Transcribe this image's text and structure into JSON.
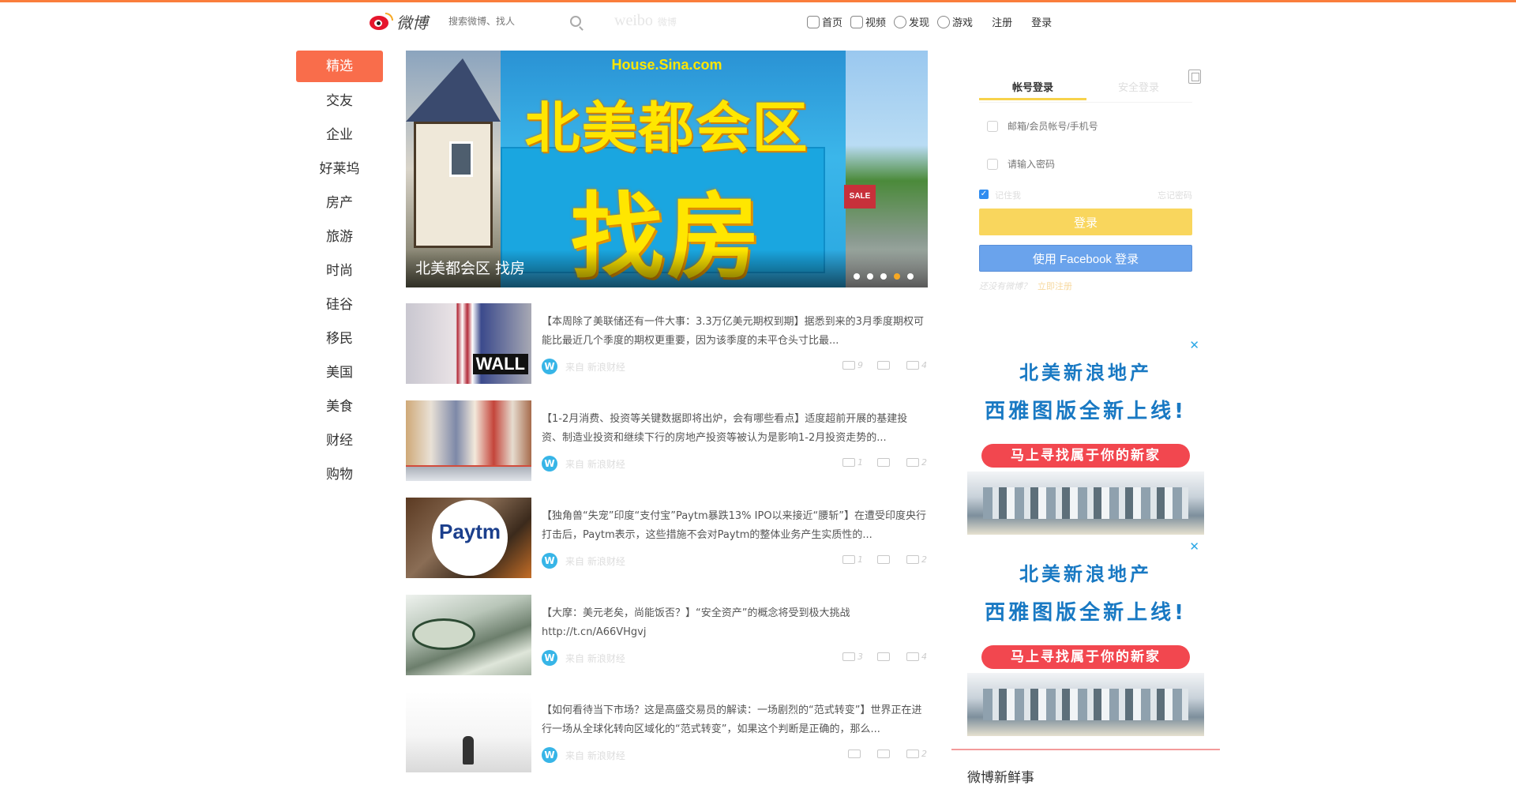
{
  "header": {
    "logo_text": "微博",
    "search_placeholder": "搜索微博、找人",
    "brand": "weibo",
    "brand_sub": "微博",
    "nav": [
      {
        "label": "首页",
        "icon": "home-icon"
      },
      {
        "label": "视频",
        "icon": "video-icon"
      },
      {
        "label": "发现",
        "icon": "discover-icon"
      },
      {
        "label": "游戏",
        "icon": "game-icon"
      }
    ],
    "register": "注册",
    "login": "登录"
  },
  "sidebar": {
    "items": [
      {
        "label": "精选",
        "active": true
      },
      {
        "label": "交友"
      },
      {
        "label": "企业"
      },
      {
        "label": "好莱坞"
      },
      {
        "label": "房产"
      },
      {
        "label": "旅游"
      },
      {
        "label": "时尚"
      },
      {
        "label": "硅谷"
      },
      {
        "label": "移民"
      },
      {
        "label": "美国"
      },
      {
        "label": "美食"
      },
      {
        "label": "财经"
      },
      {
        "label": "购物"
      }
    ]
  },
  "banner": {
    "site": "House.Sina.com",
    "headline": "北美都会区",
    "headline2": "找房",
    "sale_sign": "SALE",
    "caption": "北美都会区 找房",
    "slide_count": 5,
    "active_slide": 4
  },
  "feed": {
    "posts": [
      {
        "text": "【本周除了美联储还有一件大事：3.3万亿美元期权到期】据悉到来的3月季度期权可能比最近几个季度的期权更重要，因为该季度的未平仓头寸比最...",
        "thumb_label": "WALL",
        "source": "来自 新浪财经",
        "actions": [
          "9",
          "",
          "4"
        ]
      },
      {
        "text": "【1-2月消费、投资等关键数据即将出炉，会有哪些看点】适度超前开展的基建投资、制造业投资和继续下行的房地产投资等被认为是影响1-2月投资走势的...",
        "thumb_label": "",
        "source": "来自 新浪财经",
        "actions": [
          "1",
          "",
          "2"
        ]
      },
      {
        "text": "【独角兽“失宠”印度“支付宝”Paytm暴跌13% IPO以来接近“腰斩”】在遭受印度央行打击后，Paytm表示，这些措施不会对Paytm的整体业务产生实质性的...",
        "thumb_label": "Paytm",
        "source": "来自 新浪财经",
        "actions": [
          "1",
          "",
          "2"
        ]
      },
      {
        "text": "【大摩：美元老矣，尚能饭否？】“安全资产”的概念将受到极大挑战 http://t.cn/A66VHgvj",
        "thumb_label": "",
        "source": "来自 新浪财经",
        "actions": [
          "3",
          "",
          "4"
        ]
      },
      {
        "text": "【如何看待当下市场？这是高盛交易员的解读：一场剧烈的“范式转变”】世界正在进行一场从全球化转向区域化的“范式转变”，如果这个判断是正确的，那么...",
        "thumb_label": "",
        "source": "来自 新浪财经",
        "actions": [
          "",
          "",
          "2"
        ]
      }
    ],
    "verified_badge": "W"
  },
  "login": {
    "tab_account": "帐号登录",
    "tab_other": "安全登录",
    "username_placeholder": "邮箱/会员帐号/手机号",
    "password_placeholder": "请输入密码",
    "remember_label": "记住我",
    "forgot_label": "忘记密码",
    "login_button": "登录",
    "facebook_button": "使用 Facebook 登录",
    "register_text": "还没有微博？",
    "register_link": "立即注册"
  },
  "ads": [
    {
      "line1": "北美新浪地产",
      "line2": "西雅图版全新上线!",
      "cta": "马上寻找属于你的新家"
    },
    {
      "line1": "北美新浪地产",
      "line2": "西雅图版全新上线!",
      "cta": "马上寻找属于你的新家"
    }
  ],
  "news_section": {
    "title": "微博新鲜事"
  },
  "colors": {
    "accent": "#f96d4b",
    "login_yellow": "#f9d65d",
    "facebook_blue": "#6aa3ec",
    "ad_blue": "#1979c3",
    "ad_red": "#f2474f"
  }
}
